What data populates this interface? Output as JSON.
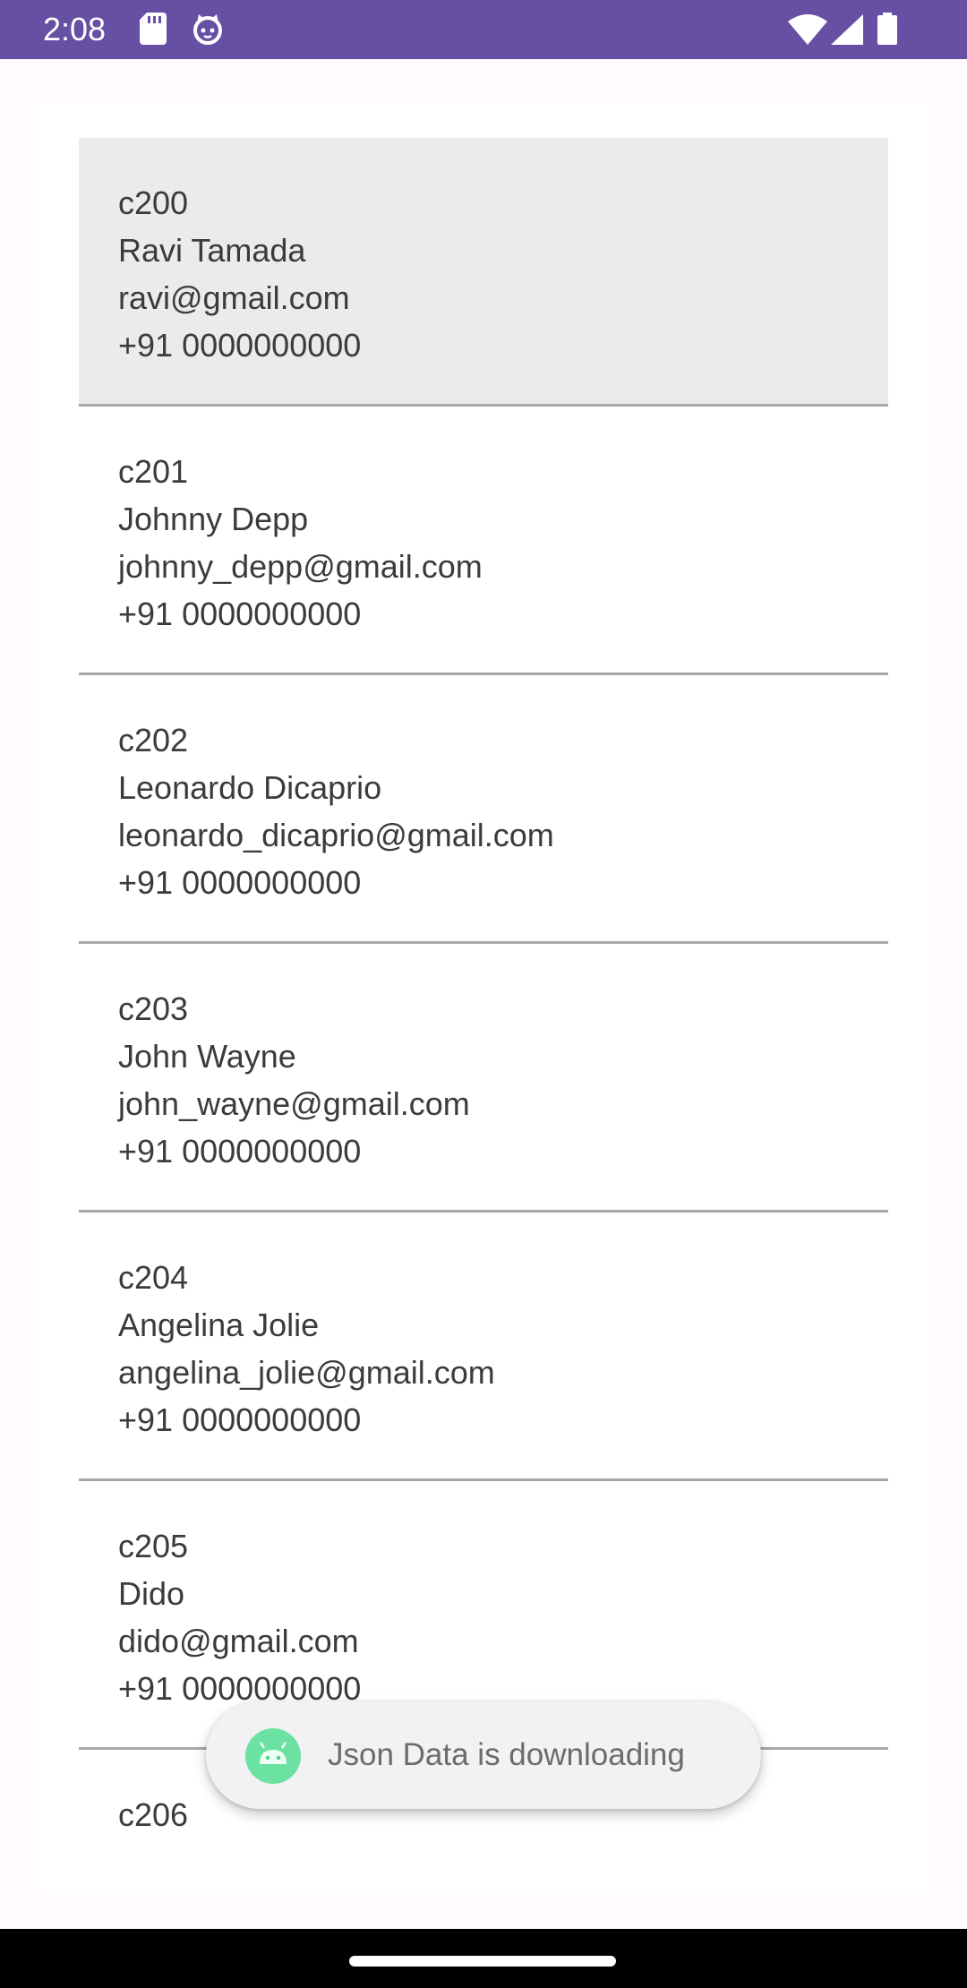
{
  "status_bar": {
    "time": "2:08",
    "icons": [
      "sd-card-icon",
      "cat-icon",
      "wifi-icon",
      "signal-icon",
      "battery-icon"
    ],
    "background": "#6750a4"
  },
  "contacts": [
    {
      "id": "c200",
      "name": "Ravi Tamada",
      "email": "ravi@gmail.com",
      "phone": "+91 0000000000"
    },
    {
      "id": "c201",
      "name": "Johnny Depp",
      "email": "johnny_depp@gmail.com",
      "phone": "+91 0000000000"
    },
    {
      "id": "c202",
      "name": "Leonardo Dicaprio",
      "email": "leonardo_dicaprio@gmail.com",
      "phone": "+91 0000000000"
    },
    {
      "id": "c203",
      "name": "John Wayne",
      "email": "john_wayne@gmail.com",
      "phone": "+91 0000000000"
    },
    {
      "id": "c204",
      "name": "Angelina Jolie",
      "email": "angelina_jolie@gmail.com",
      "phone": "+91 0000000000"
    },
    {
      "id": "c205",
      "name": "Dido",
      "email": "dido@gmail.com",
      "phone": "+91 0000000000"
    },
    {
      "id": "c206",
      "name": "",
      "email": "",
      "phone": ""
    }
  ],
  "toast": {
    "icon": "android-icon",
    "message": "Json Data is downloading"
  },
  "colors": {
    "selected_row": "#ebebeb",
    "divider": "#a7a7a7",
    "text": "#3b3b3b"
  }
}
